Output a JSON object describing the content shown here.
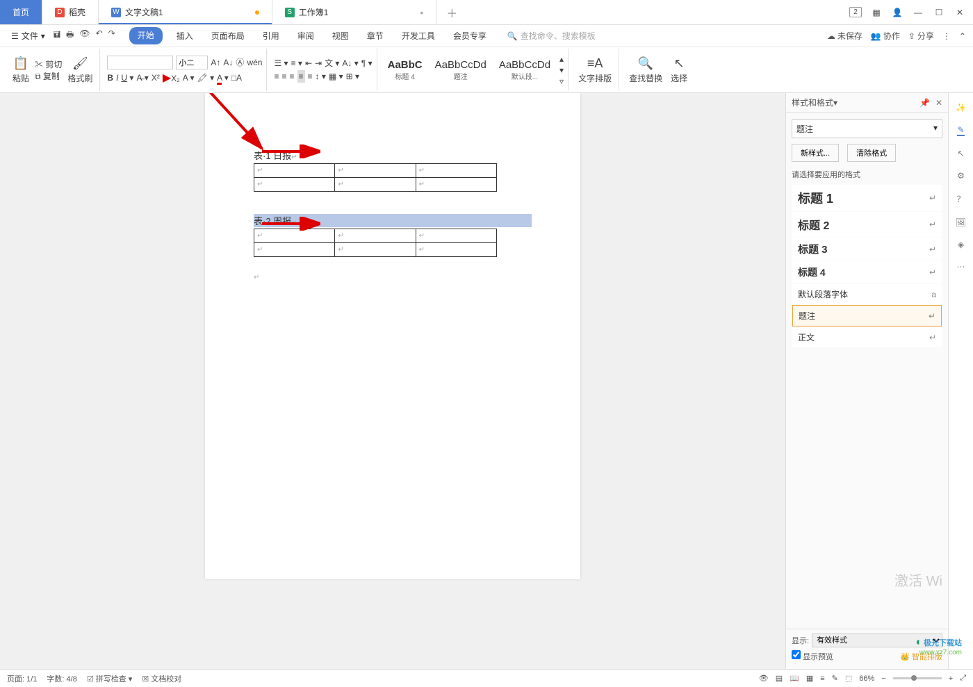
{
  "tabs": {
    "home": "首页",
    "doke": "稻壳",
    "doc1": "文字文稿1",
    "sheet": "工作簿1"
  },
  "winControls": {
    "badge": "2"
  },
  "menuBar": {
    "file": "文件",
    "tabs": [
      "开始",
      "插入",
      "页面布局",
      "引用",
      "审阅",
      "视图",
      "章节",
      "开发工具",
      "会员专享"
    ],
    "searchPlaceholder": "查找命令、搜索模板",
    "right": {
      "unsaved": "未保存",
      "collab": "协作",
      "share": "分享"
    }
  },
  "ribbon": {
    "paste": "粘贴",
    "cut": "剪切",
    "copy": "复制",
    "formatPainter": "格式刷",
    "fontSize": "小二",
    "styles": [
      {
        "preview": "AaBbC",
        "label": "标题 4"
      },
      {
        "preview": "AaBbCcDd",
        "label": "题注"
      },
      {
        "preview": "AaBbCcDd",
        "label": "默认段..."
      }
    ],
    "textLayout": "文字排版",
    "findReplace": "查找替换",
    "select": "选择"
  },
  "doc": {
    "caption1": "表·1 日报",
    "caption2": "表·2 周报"
  },
  "panel": {
    "title": "样式和格式",
    "currentStyle": "题注",
    "newStyle": "新样式...",
    "clearFormat": "清除格式",
    "selectLabel": "请选择要应用的格式",
    "items": [
      {
        "name": "标题 1",
        "mark": "↵",
        "font": "18px",
        "bold": true
      },
      {
        "name": "标题 2",
        "mark": "↵",
        "font": "16px",
        "bold": true
      },
      {
        "name": "标题 3",
        "mark": "↵",
        "font": "15px",
        "bold": true
      },
      {
        "name": "标题 4",
        "mark": "↵",
        "font": "14px",
        "bold": true
      },
      {
        "name": "默认段落字体",
        "mark": "a",
        "font": "12px",
        "bold": false
      },
      {
        "name": "题注",
        "mark": "↵",
        "font": "12px",
        "bold": false,
        "sel": true
      },
      {
        "name": "正文",
        "mark": "↵",
        "font": "12px",
        "bold": false
      }
    ],
    "showLabel": "显示:",
    "showValue": "有效样式",
    "preview": "显示预览",
    "smartLayout": "智能排版"
  },
  "status": {
    "page": "页面: 1/1",
    "words": "字数: 4/8",
    "spell": "拼写检查",
    "docCheck": "文档校对",
    "zoom": "66%"
  },
  "watermark": {
    "l1": "极光下载站",
    "l2": "www.xz7.com"
  },
  "activate": "激活 Wi"
}
